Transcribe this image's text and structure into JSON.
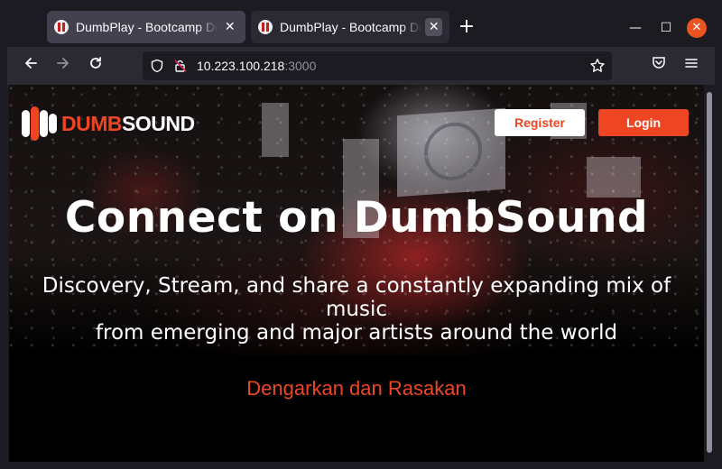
{
  "browser": {
    "tabs": [
      {
        "title": "DumbPlay - Bootcamp Dem",
        "active": true
      },
      {
        "title": "DumbPlay - Bootcamp De",
        "active": false
      }
    ],
    "tab_close_glyph": "✕",
    "new_tab_glyph": "+",
    "url": {
      "host": "10.223.100.218",
      "port": ":3000"
    },
    "icons": [
      "back-icon",
      "forward-icon",
      "reload-icon",
      "shield-icon",
      "lock-warning-icon",
      "bookmark-star-icon",
      "pocket-icon",
      "menu-icon",
      "minimize-icon",
      "maximize-icon",
      "close-icon"
    ],
    "window_controls": {
      "minimize": "—",
      "maximize": "☐",
      "close": "✕"
    }
  },
  "site": {
    "logo": {
      "dumb": "DUMB",
      "sound": "SOUND"
    },
    "nav": {
      "register": "Register",
      "login": "Login"
    },
    "hero": {
      "title": "Connect on DumbSound",
      "subtitle_line1": "Discovery, Stream, and share a constantly expanding mix of music",
      "subtitle_line2": "from emerging and major artists around the world",
      "cta": "Dengarkan dan Rasakan"
    },
    "colors": {
      "accent": "#ee4622",
      "background": "#000000"
    }
  }
}
